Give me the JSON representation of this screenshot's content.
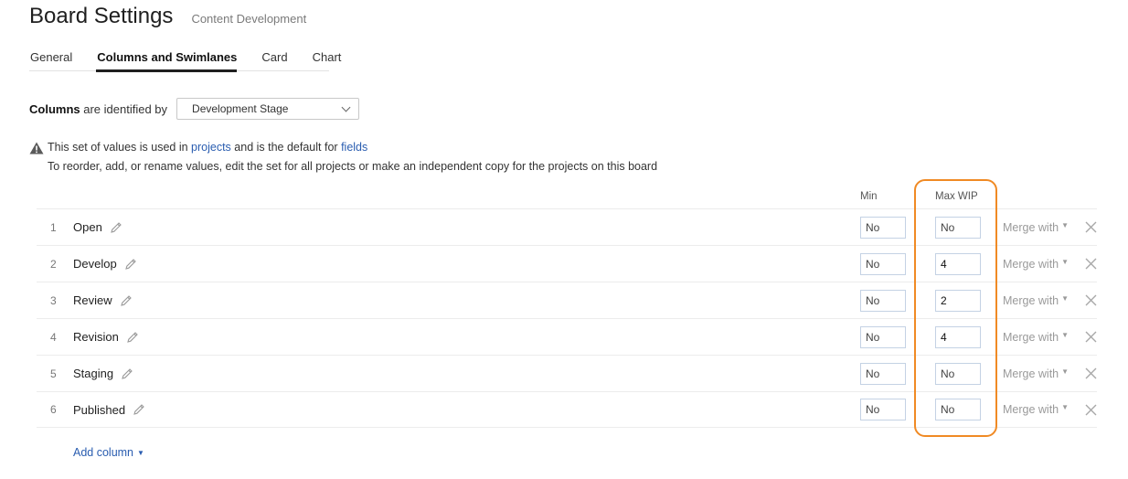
{
  "header": {
    "title": "Board Settings",
    "subtitle": "Content Development"
  },
  "tabs": [
    {
      "label": "General",
      "active": false
    },
    {
      "label": "Columns and Swimlanes",
      "active": true
    },
    {
      "label": "Card",
      "active": false
    },
    {
      "label": "Chart",
      "active": false
    }
  ],
  "columns_ident": {
    "label_bold": "Columns",
    "label_rest": " are identified by",
    "selected": "Development Stage"
  },
  "notice": {
    "p1": "This set of values is used in ",
    "link1": "projects",
    "p2": " and is the default for ",
    "link2": "fields",
    "line2": "To reorder, add, or rename values, edit the set for all projects or make an independent copy for the projects on this board"
  },
  "table": {
    "min_header": "Min",
    "wip_header": "Max WIP",
    "merge_label": "Merge with",
    "rows": [
      {
        "num": "1",
        "name": "Open",
        "min": "No",
        "wip": "No"
      },
      {
        "num": "2",
        "name": "Develop",
        "min": "No",
        "wip": "4"
      },
      {
        "num": "3",
        "name": "Review",
        "min": "No",
        "wip": "2"
      },
      {
        "num": "4",
        "name": "Revision",
        "min": "No",
        "wip": "4"
      },
      {
        "num": "5",
        "name": "Staging",
        "min": "No",
        "wip": "No"
      },
      {
        "num": "6",
        "name": "Published",
        "min": "No",
        "wip": "No"
      }
    ]
  },
  "add_column_label": "Add column",
  "colors": {
    "accent_link": "#2a5db0",
    "highlight": "#f08a24",
    "input_border": "#c4d2e4"
  },
  "icons": {
    "warning": "warning-icon",
    "edit": "pencil-icon",
    "delete": "close-icon",
    "dropdown": "caret-down-icon"
  }
}
